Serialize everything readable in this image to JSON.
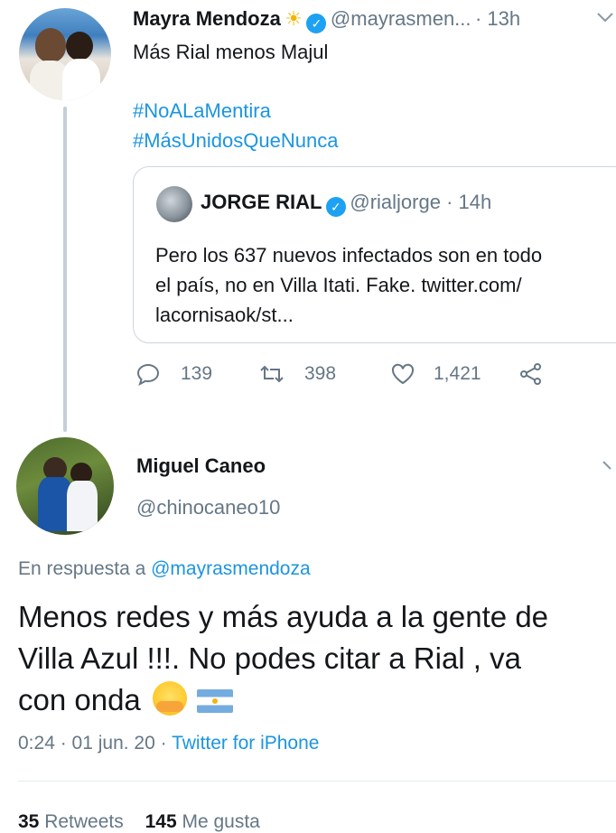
{
  "tweet1": {
    "name": "Mayra Mendoza",
    "name_icon": "sun-emoji",
    "handle": "@mayrasmen...",
    "time": "· 13h",
    "text": "Más Rial menos Majul",
    "hashtags": [
      "#NoALaMentira",
      "#MásUnidosQueNunca"
    ]
  },
  "quoted": {
    "name": "JORGE RIAL",
    "handle": "@rialjorge · 14h",
    "text_lines": [
      "Pero los 637 nuevos infectados son en todo",
      "el país, no en Villa Itati. Fake. twitter.com/",
      "lacornisaok/st..."
    ]
  },
  "actions": {
    "replies": "139",
    "retweets": "398",
    "likes": "1,421"
  },
  "tweet2": {
    "name": "Miguel Caneo",
    "handle": "@chinocaneo10",
    "reply_prefix": "En respuesta a",
    "reply_to": "@mayrasmendoza",
    "text_lines": [
      "Menos redes y más ayuda a la gente de",
      "Villa Azul !!!. No podes citar a Rial , va",
      "con onda"
    ],
    "time": "0:24 · 01 jun. 20 · ",
    "source": "Twitter for iPhone"
  },
  "stats": {
    "retweets_count": "35",
    "retweets_label": "Retweets",
    "likes_count": "145",
    "likes_label": "Me gusta"
  },
  "colors": {
    "link": "#1b95e0",
    "secondary": "#657786",
    "verified": "#1da1f2"
  }
}
